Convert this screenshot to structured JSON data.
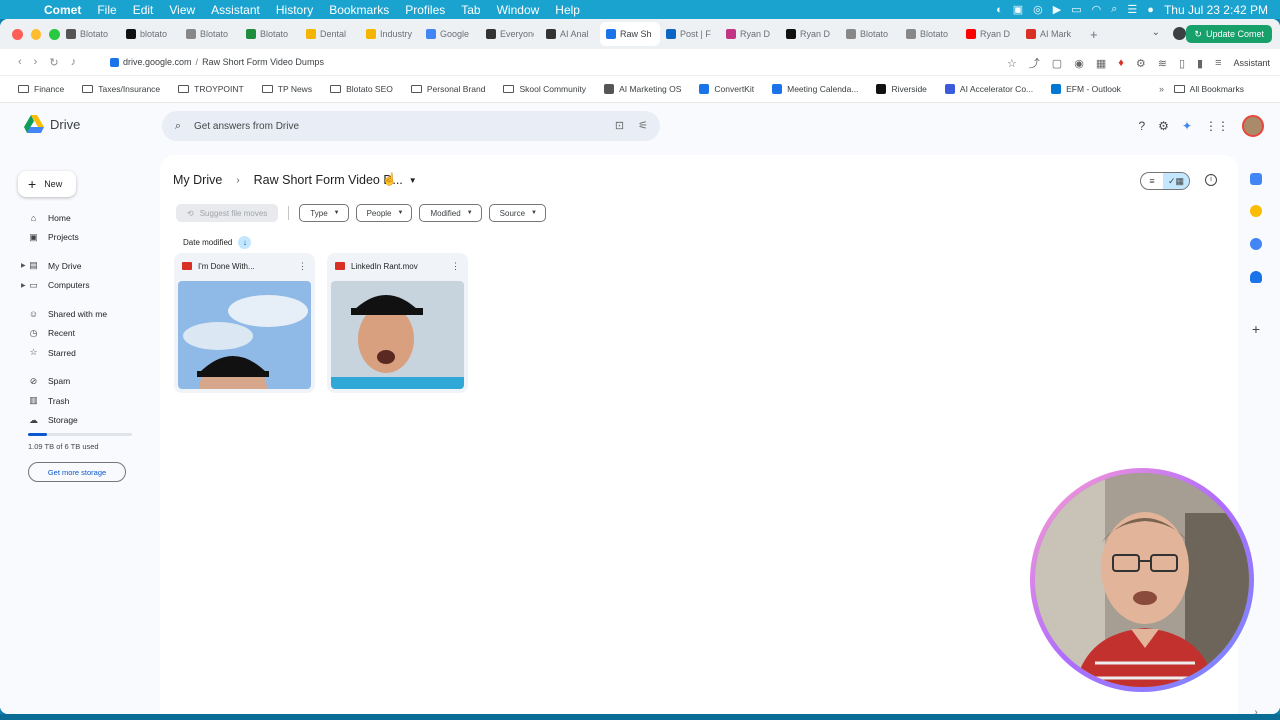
{
  "menubar": {
    "app": "Comet",
    "items": [
      "File",
      "Edit",
      "View",
      "Assistant",
      "History",
      "Bookmarks",
      "Profiles",
      "Tab",
      "Window",
      "Help"
    ],
    "datetime": "Thu Jul 23  2:42 PM"
  },
  "tabs": [
    {
      "label": "Blotato",
      "color": "#555555"
    },
    {
      "label": "blotato",
      "color": "#111111"
    },
    {
      "label": "Blotato",
      "color": "#888888"
    },
    {
      "label": "Blotato",
      "color": "#1e8e3e"
    },
    {
      "label": "Dental",
      "color": "#f4b400"
    },
    {
      "label": "Industry",
      "color": "#f4b400"
    },
    {
      "label": "Google",
      "color": "#4285f4"
    },
    {
      "label": "Everyone",
      "color": "#333333"
    },
    {
      "label": "AI Anal",
      "color": "#333333"
    },
    {
      "label": "Raw Sh",
      "color": "#1a73e8",
      "active": true
    },
    {
      "label": "Post | F",
      "color": "#0a66c2"
    },
    {
      "label": "Ryan D",
      "color": "#c13584"
    },
    {
      "label": "Ryan D",
      "color": "#111111"
    },
    {
      "label": "Blotato",
      "color": "#888888"
    },
    {
      "label": "Blotato",
      "color": "#888888"
    },
    {
      "label": "Ryan D",
      "color": "#ff0000"
    },
    {
      "label": "AI Mark",
      "color": "#d93025"
    }
  ],
  "update_button": "Update Comet",
  "address": {
    "domain": "drive.google.com",
    "separator": "/",
    "path": "Raw Short Form Video Dumps",
    "assistant": "Assistant"
  },
  "bookmarks": [
    {
      "label": "Finance",
      "type": "folder"
    },
    {
      "label": "Taxes/Insurance",
      "type": "folder"
    },
    {
      "label": "TROYPOINT",
      "type": "folder"
    },
    {
      "label": "TP News",
      "type": "folder"
    },
    {
      "label": "Blotato SEO",
      "type": "folder"
    },
    {
      "label": "Personal Brand",
      "type": "folder"
    },
    {
      "label": "Skool Community",
      "type": "folder"
    },
    {
      "label": "AI Marketing OS",
      "type": "site",
      "color": "#555555"
    },
    {
      "label": "ConvertKit",
      "type": "site",
      "color": "#1a73e8"
    },
    {
      "label": "Meeting Calenda...",
      "type": "site",
      "color": "#1a73e8"
    },
    {
      "label": "Riverside",
      "type": "site",
      "color": "#111111"
    },
    {
      "label": "AI Accelerator Co...",
      "type": "site",
      "color": "#3b5bdb"
    },
    {
      "label": "EFM - Outlook",
      "type": "site",
      "color": "#0078d4"
    }
  ],
  "all_bookmarks": "All Bookmarks",
  "drive": {
    "product": "Drive",
    "search_placeholder": "Get answers from Drive",
    "new_label": "New",
    "nav": [
      {
        "label": "Home",
        "icon": "home-icon"
      },
      {
        "label": "Projects",
        "icon": "projects-icon"
      },
      {
        "label": "My Drive",
        "icon": "my-drive-icon"
      },
      {
        "label": "Computers",
        "icon": "computers-icon"
      },
      {
        "label": "Shared with me",
        "icon": "shared-icon"
      },
      {
        "label": "Recent",
        "icon": "recent-icon"
      },
      {
        "label": "Starred",
        "icon": "star-icon"
      },
      {
        "label": "Spam",
        "icon": "spam-icon"
      },
      {
        "label": "Trash",
        "icon": "trash-icon"
      },
      {
        "label": "Storage",
        "icon": "cloud-icon"
      }
    ],
    "storage_used_fraction": 0.18,
    "storage_text": "1.09 TB of 6 TB used",
    "get_more_storage": "Get more storage",
    "breadcrumb_root": "My Drive",
    "breadcrumb_current": "Raw Short Form Video D...",
    "filters": {
      "suggest": "Suggest file moves",
      "chips": [
        "Type",
        "People",
        "Modified",
        "Source"
      ]
    },
    "sort_label": "Date modified",
    "files": [
      {
        "name": "I'm Done With...",
        "kind": "video"
      },
      {
        "name": "LinkedIn Rant.mov",
        "kind": "video"
      }
    ]
  }
}
